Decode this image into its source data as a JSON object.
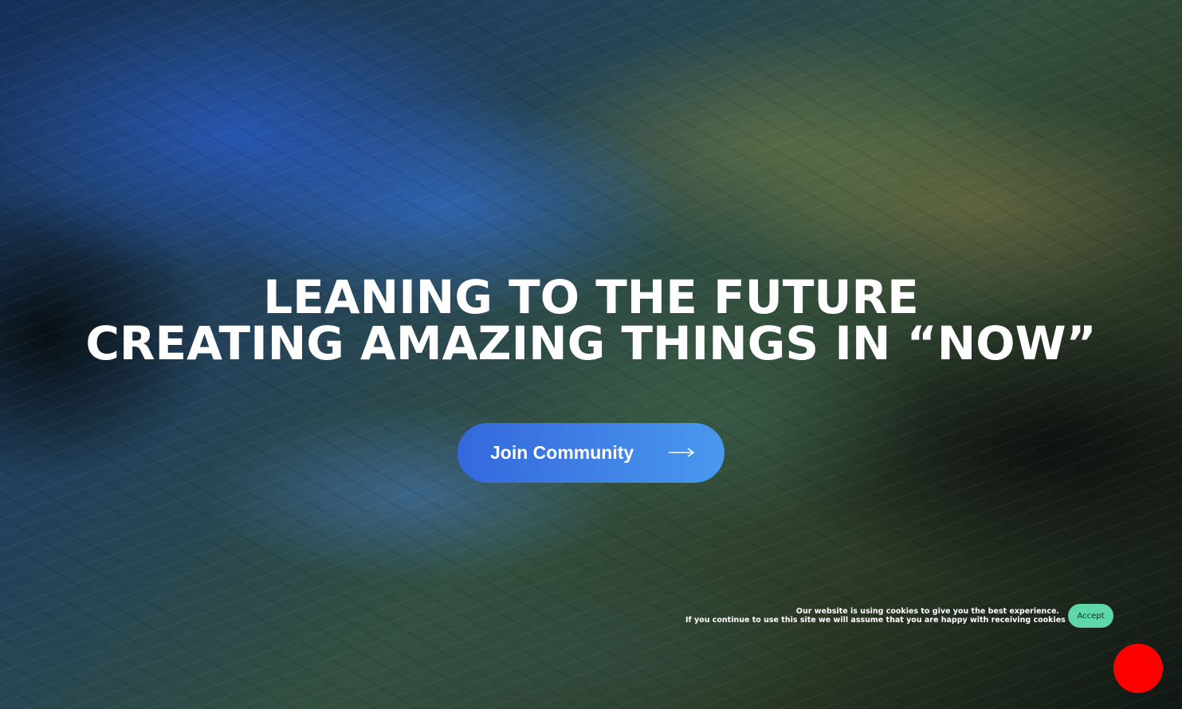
{
  "hero": {
    "title_line1": "LEANING TO THE FUTURE",
    "title_line2": "CREATING AMAZING THINGS IN “NOW”",
    "cta_label": "Join Community",
    "cta_icon": "arrow-right-icon"
  },
  "cookie_notice": {
    "line1": "Our website is using cookies to give you the best experience.",
    "line2": "If you continue to use this site we will assume that you are happy with receiving cookies",
    "accept_label": "Accept",
    "accept_color": "#5fd7a6"
  },
  "chat_widget": {
    "color": "#ff0000"
  },
  "colors": {
    "button_gradient_start": "#3468dc",
    "button_gradient_end": "#4a98ee",
    "text": "#ffffff"
  }
}
